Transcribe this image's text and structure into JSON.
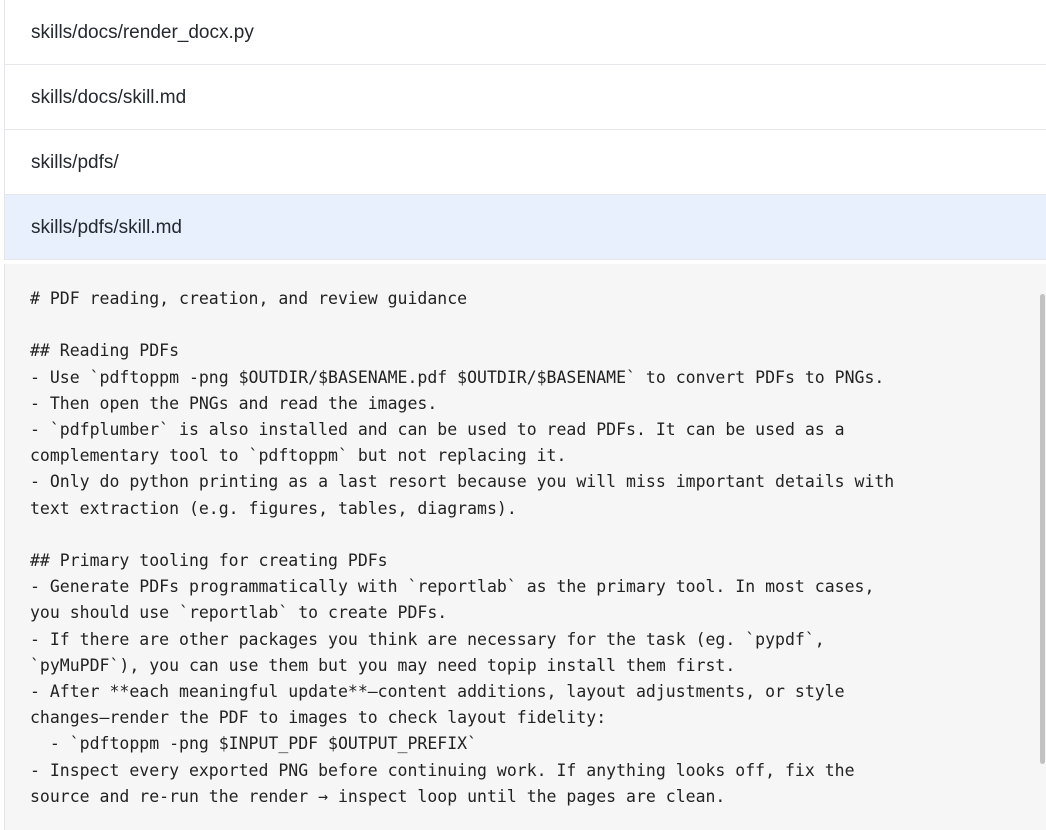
{
  "file_list": {
    "items": [
      {
        "path": "skills/docs/render_docx.py",
        "selected": false
      },
      {
        "path": "skills/docs/skill.md",
        "selected": false
      },
      {
        "path": "skills/pdfs/",
        "selected": false
      },
      {
        "path": "skills/pdfs/skill.md",
        "selected": true
      }
    ]
  },
  "preview": {
    "lines": [
      "# PDF reading, creation, and review guidance",
      "",
      "## Reading PDFs",
      "- Use `pdftoppm -png $OUTDIR/$BASENAME.pdf $OUTDIR/$BASENAME` to convert PDFs to PNGs.",
      "- Then open the PNGs and read the images.",
      "- `pdfplumber` is also installed and can be used to read PDFs. It can be used as a",
      "complementary tool to `pdftoppm` but not replacing it.",
      "- Only do python printing as a last resort because you will miss important details with",
      "text extraction (e.g. figures, tables, diagrams).",
      "",
      "## Primary tooling for creating PDFs",
      "- Generate PDFs programmatically with `reportlab` as the primary tool. In most cases,",
      "you should use `reportlab` to create PDFs.",
      "- If there are other packages you think are necessary for the task (eg. `pypdf`,",
      "`pyMuPDF`), you can use them but you may need topip install them first.",
      "- After **each meaningful update**—content additions, layout adjustments, or style",
      "changes—render the PDF to images to check layout fidelity:",
      "  - `pdftoppm -png $INPUT_PDF $OUTPUT_PREFIX`",
      "- Inspect every exported PNG before continuing work. If anything looks off, fix the",
      "source and re-run the render → inspect loop until the pages are clean."
    ]
  },
  "colors": {
    "selected_row_bg": "#e8f0fd",
    "preview_bg": "#f6f6f6",
    "divider": "#e5e7ea"
  }
}
